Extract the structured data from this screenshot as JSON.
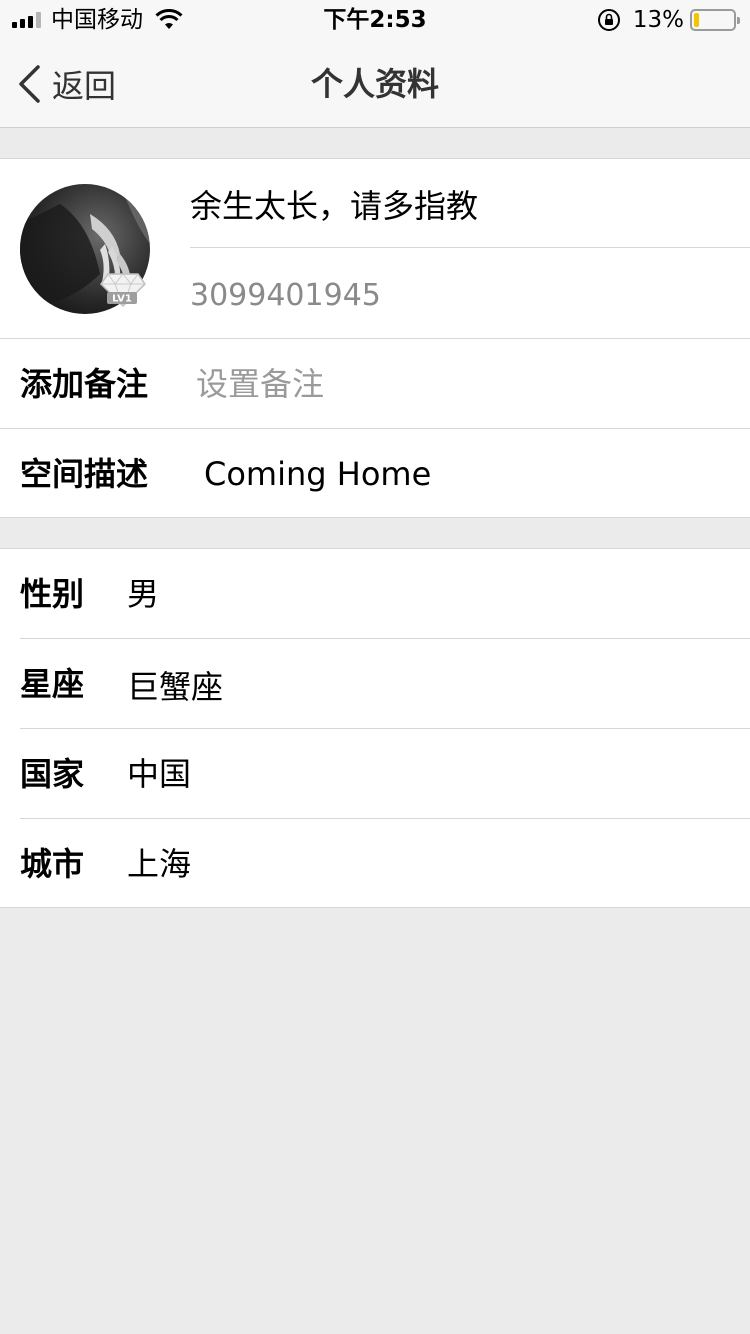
{
  "status_bar": {
    "carrier": "中国移动",
    "time": "下午2:53",
    "battery_percent": "13%",
    "battery_level": 0.13,
    "icons": [
      "signal-icon",
      "wifi-icon",
      "orientation-lock-icon",
      "battery-icon"
    ]
  },
  "nav": {
    "back_label": "返回",
    "title": "个人资料",
    "back_icon": "chevron-left-icon"
  },
  "profile": {
    "nickname": "余生太长，请多指教",
    "uid": "3099401945",
    "level_badge": "LV1"
  },
  "remark": {
    "label": "添加备注",
    "placeholder": "设置备注",
    "value": ""
  },
  "space": {
    "label": "空间描述",
    "value": "Coming  Home"
  },
  "info": [
    {
      "label": "性别",
      "value": "男"
    },
    {
      "label": "星座",
      "value": "巨蟹座"
    },
    {
      "label": "国家",
      "value": "中国"
    },
    {
      "label": "城市",
      "value": "上海"
    }
  ],
  "colors": {
    "background": "#ebebeb",
    "bar_background": "#f7f7f7",
    "battery_fill": "#f5c400",
    "secondary_text": "#8a8a8a"
  }
}
